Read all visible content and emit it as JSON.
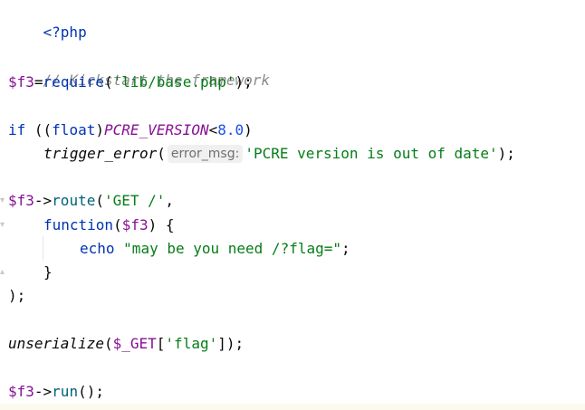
{
  "code": {
    "l1": "<?php",
    "l3": "// Kickstart the framework",
    "l4_var": "$f3",
    "l4_eq": "=",
    "l4_fn": "require",
    "l4_open": "(",
    "l4_str": "'lib/base.php'",
    "l4_close": ");",
    "l6_if": "if",
    "l6_open": " ((",
    "l6_cast": "float",
    "l6_cclose": ")",
    "l6_const": "PCRE_VERSION",
    "l6_lt": "<",
    "l6_num": "8.0",
    "l6_close": ")",
    "l7_fn": "trigger_error",
    "l7_open": "(",
    "l7_hint": "error_msg:",
    "l7_str": "'PCRE version is out of date'",
    "l7_close": ");",
    "l9_var": "$f3",
    "l9_arrow": "->",
    "l9_fn": "route",
    "l9_open": "(",
    "l9_str": "'GET /'",
    "l9_comma": ",",
    "l10_kw": "function",
    "l10_open": "(",
    "l10_param": "$f3",
    "l10_close": ") {",
    "l11_kw": "echo",
    "l11_str": "\"may be you need /?flag=\"",
    "l11_semi": ";",
    "l12": "}",
    "l13": ");",
    "l15_fn": "unserialize",
    "l15_open": "(",
    "l15_var": "$_GET",
    "l15_br": "[",
    "l15_str": "'flag'",
    "l15_close": "]);",
    "l17_var": "$f3",
    "l17_arrow": "->",
    "l17_fn": "run",
    "l17_close": "();"
  },
  "colors": {
    "keyword": "#0033b3",
    "string": "#067d17",
    "variable": "#871094",
    "function": "#00627a",
    "comment": "#8c8c8c",
    "number": "#1750eb"
  }
}
